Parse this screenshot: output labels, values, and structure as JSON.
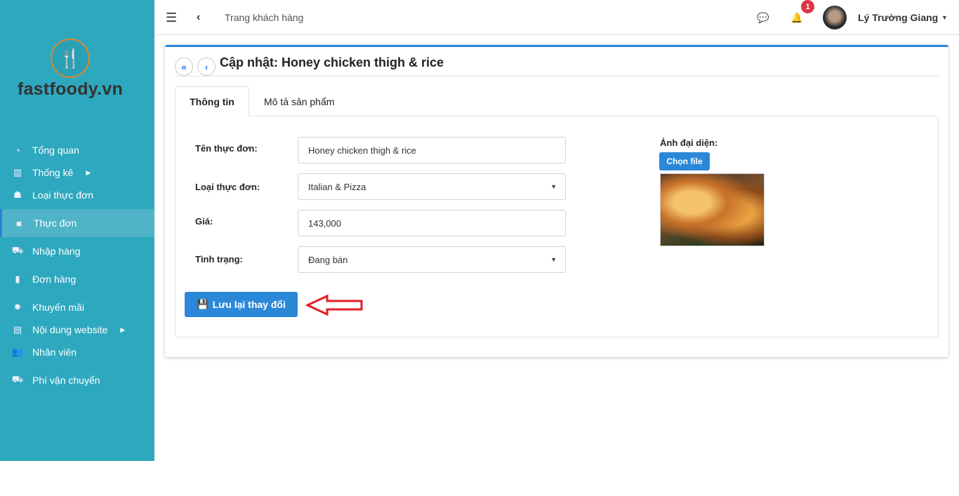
{
  "brand": {
    "name": "fastfoody.vn"
  },
  "sidebar": {
    "items": [
      {
        "label": "Tổng quan",
        "icon": "tachometer-icon"
      },
      {
        "label": "Thống kê",
        "icon": "chart-bar-icon",
        "submenu": true
      },
      {
        "label": "Loại thực đơn",
        "icon": "sitemap-icon"
      },
      {
        "label": "Thực đơn",
        "icon": "box-icon",
        "active": true
      },
      {
        "label": "Nhập hàng",
        "icon": "dolly-icon"
      },
      {
        "label": "Đơn hàng",
        "icon": "clipboard-icon"
      },
      {
        "label": "Khuyến mãi",
        "icon": "certificate-icon"
      },
      {
        "label": "Nội dung website",
        "icon": "newspaper-icon",
        "submenu": true
      },
      {
        "label": "Nhân viên",
        "icon": "users-icon"
      },
      {
        "label": "Phí vận chuyển",
        "icon": "truck-icon"
      }
    ]
  },
  "topbar": {
    "page_link": "Trang khách hàng",
    "notification_count": "1",
    "user_name": "Lý Trường Giang"
  },
  "card": {
    "title": "Cập nhật: Honey chicken thigh & rice",
    "tabs": [
      "Thông tin",
      "Mô tả sản phẩm"
    ],
    "form": {
      "name_label": "Tên thực đơn:",
      "name_value": "Honey chicken thigh & rice",
      "category_label": "Loại thực đơn:",
      "category_value": "Italian & Pizza",
      "price_label": "Giá:",
      "price_value": "143,000",
      "status_label": "Tình trạng:",
      "status_value": "Đang bán",
      "image_label": "Ảnh đại diện:",
      "choose_file": "Chọn file",
      "save_label": "Lưu lại thay đổi"
    }
  },
  "colors": {
    "sidebar": "#2ea8be",
    "primary": "#2b88d8",
    "badge": "#dc3545",
    "arrow": "#e41e26"
  }
}
